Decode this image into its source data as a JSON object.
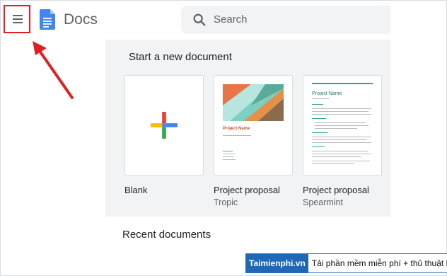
{
  "header": {
    "app_title": "Docs",
    "menu_icon": "hamburger-menu-icon",
    "logo_icon": "docs-logo-icon",
    "search": {
      "placeholder": "Search",
      "value": "",
      "icon": "search-icon"
    }
  },
  "templates": {
    "title": "Start a new document",
    "items": [
      {
        "name": "Blank",
        "sub": ""
      },
      {
        "name": "Project proposal",
        "sub": "Tropic"
      },
      {
        "name": "Project proposal",
        "sub": "Spearmint"
      }
    ],
    "tropic_thumb_title": "Project Name",
    "spearmint_thumb_title": "Project Name"
  },
  "recent": {
    "title": "Recent documents"
  },
  "watermark": {
    "brand": "Taimienphi.vn",
    "tagline": "Tải phần mềm miễn phí + thủ thuật hay"
  },
  "colors": {
    "annotation_red": "#e02020",
    "docs_blue": "#4285f4",
    "google_red": "#ea4335",
    "google_yellow": "#fbbc04",
    "google_green": "#34a853",
    "template_bg": "#f1f3f4"
  }
}
